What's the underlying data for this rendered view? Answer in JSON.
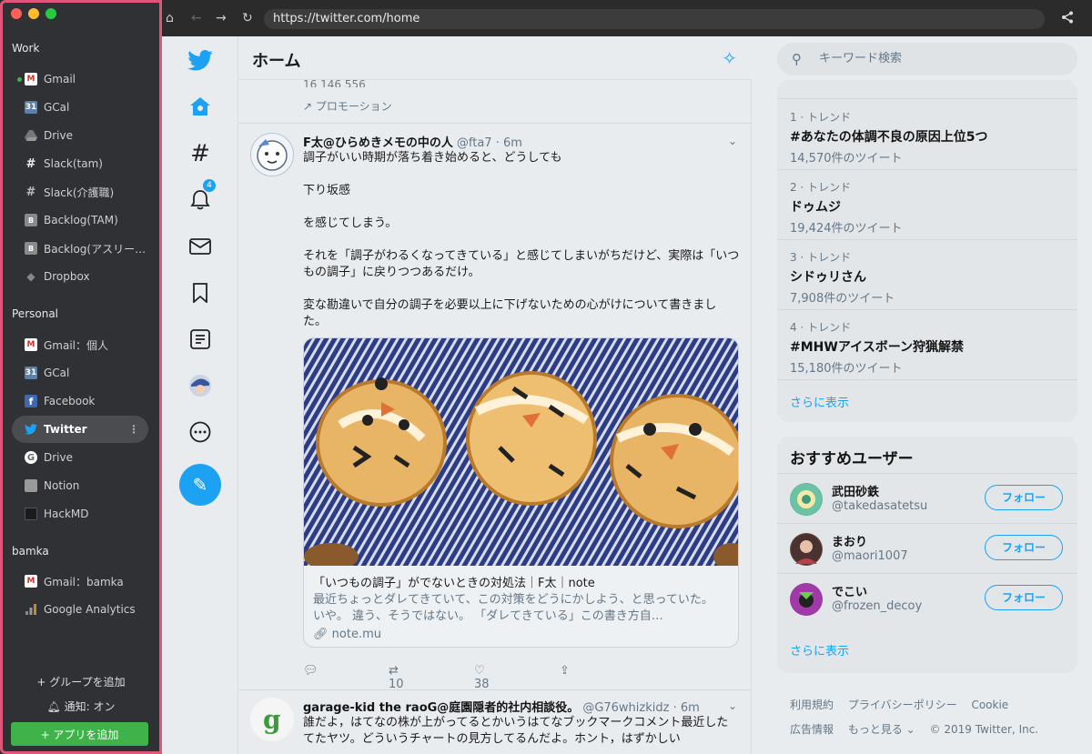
{
  "sidebar": {
    "groups": [
      {
        "title": "Work",
        "items": [
          {
            "label": "Gmail",
            "icon": "gmail-icon"
          },
          {
            "label": "GCal",
            "icon": "gcal-icon"
          },
          {
            "label": "Drive",
            "icon": "drive-icon"
          },
          {
            "label": "Slack(tam)",
            "icon": "slack-icon"
          },
          {
            "label": "Slack(介護職)",
            "icon": "slack-icon"
          },
          {
            "label": "Backlog(TAM)",
            "icon": "backlog-icon"
          },
          {
            "label": "Backlog(アスリー…",
            "icon": "backlog-icon"
          },
          {
            "label": "Dropbox",
            "icon": "dropbox-icon"
          }
        ]
      },
      {
        "title": "Personal",
        "items": [
          {
            "label": "Gmail：個人",
            "icon": "gmail-icon"
          },
          {
            "label": "GCal",
            "icon": "gcal-icon"
          },
          {
            "label": "Facebook",
            "icon": "facebook-icon"
          },
          {
            "label": "Twitter",
            "icon": "twitter-icon"
          },
          {
            "label": "Drive",
            "icon": "google-icon"
          },
          {
            "label": "Notion",
            "icon": "folder-icon"
          },
          {
            "label": "HackMD",
            "icon": "document-icon"
          }
        ]
      },
      {
        "title": "bamka",
        "items": [
          {
            "label": "Gmail：bamka",
            "icon": "gmail-icon"
          },
          {
            "label": "Google Analytics",
            "icon": "analytics-icon"
          }
        ]
      }
    ],
    "add_group": "+ グループを追加",
    "notify": "通知: オン",
    "add_app": "+ アプリを追加"
  },
  "browser": {
    "url": "https://twitter.com/home"
  },
  "twitter": {
    "header_title": "ホーム",
    "notifications_badge": "4",
    "promo_stats": "16    146    556",
    "promotion_label": "プロモーション",
    "tweets": [
      {
        "name": "F太@ひらめきメモの中の人",
        "handle": "@fta7 · 6m",
        "body": [
          "調子がいい時期が落ち着き始めると、どうしても",
          "下り坂感",
          "を感じてしまう。",
          "それを「調子がわるくなってきている」と感じてしまいがちだけど、実際は「いつもの調子」に戻りつつあるだけ。",
          "変な勘違いで自分の調子を必要以上に下げないための心がけについて書きました。"
        ],
        "card_title": "「いつもの調子」がでないときの対処法｜F太｜note",
        "card_desc": "最近ちょっとダレてきていて、この対策をどうにかしよう、と思っていた。 いや。 違う、そうではない。 「ダレてきている」この書き方自…",
        "card_link": "note.mu",
        "retweets": "10",
        "likes": "38"
      },
      {
        "name": "garage-kid the raoG@庭園隠者的社内相談役。",
        "handle": "@G76whizkidz · 6m",
        "body": "誰だよ，はてなの株が上がってるとかいうはてなブックマークコメント最近したてたヤツ。どういうチャートの見方してるんだよ。ホント，はずかしい"
      }
    ],
    "search_placeholder": "キーワード検索",
    "trends": [
      {
        "meta": "1 · トレンド",
        "name": "#あなたの体調不良の原因上位5つ",
        "count": "14,570件のツイート"
      },
      {
        "meta": "2 · トレンド",
        "name": "ドゥムジ",
        "count": "19,424件のツイート"
      },
      {
        "meta": "3 · トレンド",
        "name": "シドゥリさん",
        "count": "7,908件のツイート"
      },
      {
        "meta": "4 · トレンド",
        "name": "#MHWアイスボーン狩猟解禁",
        "count": "15,180件のツイート"
      }
    ],
    "show_more": "さらに表示",
    "who_to_follow_title": "おすすめユーザー",
    "users": [
      {
        "name": "武田砂鉄",
        "handle": "@takedasatetsu"
      },
      {
        "name": "まおり",
        "handle": "@maori1007"
      },
      {
        "name": "でこい",
        "handle": "@frozen_decoy"
      }
    ],
    "follow_label": "フォロー",
    "footer": {
      "terms": "利用規約",
      "privacy": "プライバシーポリシー",
      "cookie": "Cookie",
      "ads": "広告情報",
      "more": "もっと見る ⌄",
      "copyright": "© 2019 Twitter, Inc."
    }
  }
}
